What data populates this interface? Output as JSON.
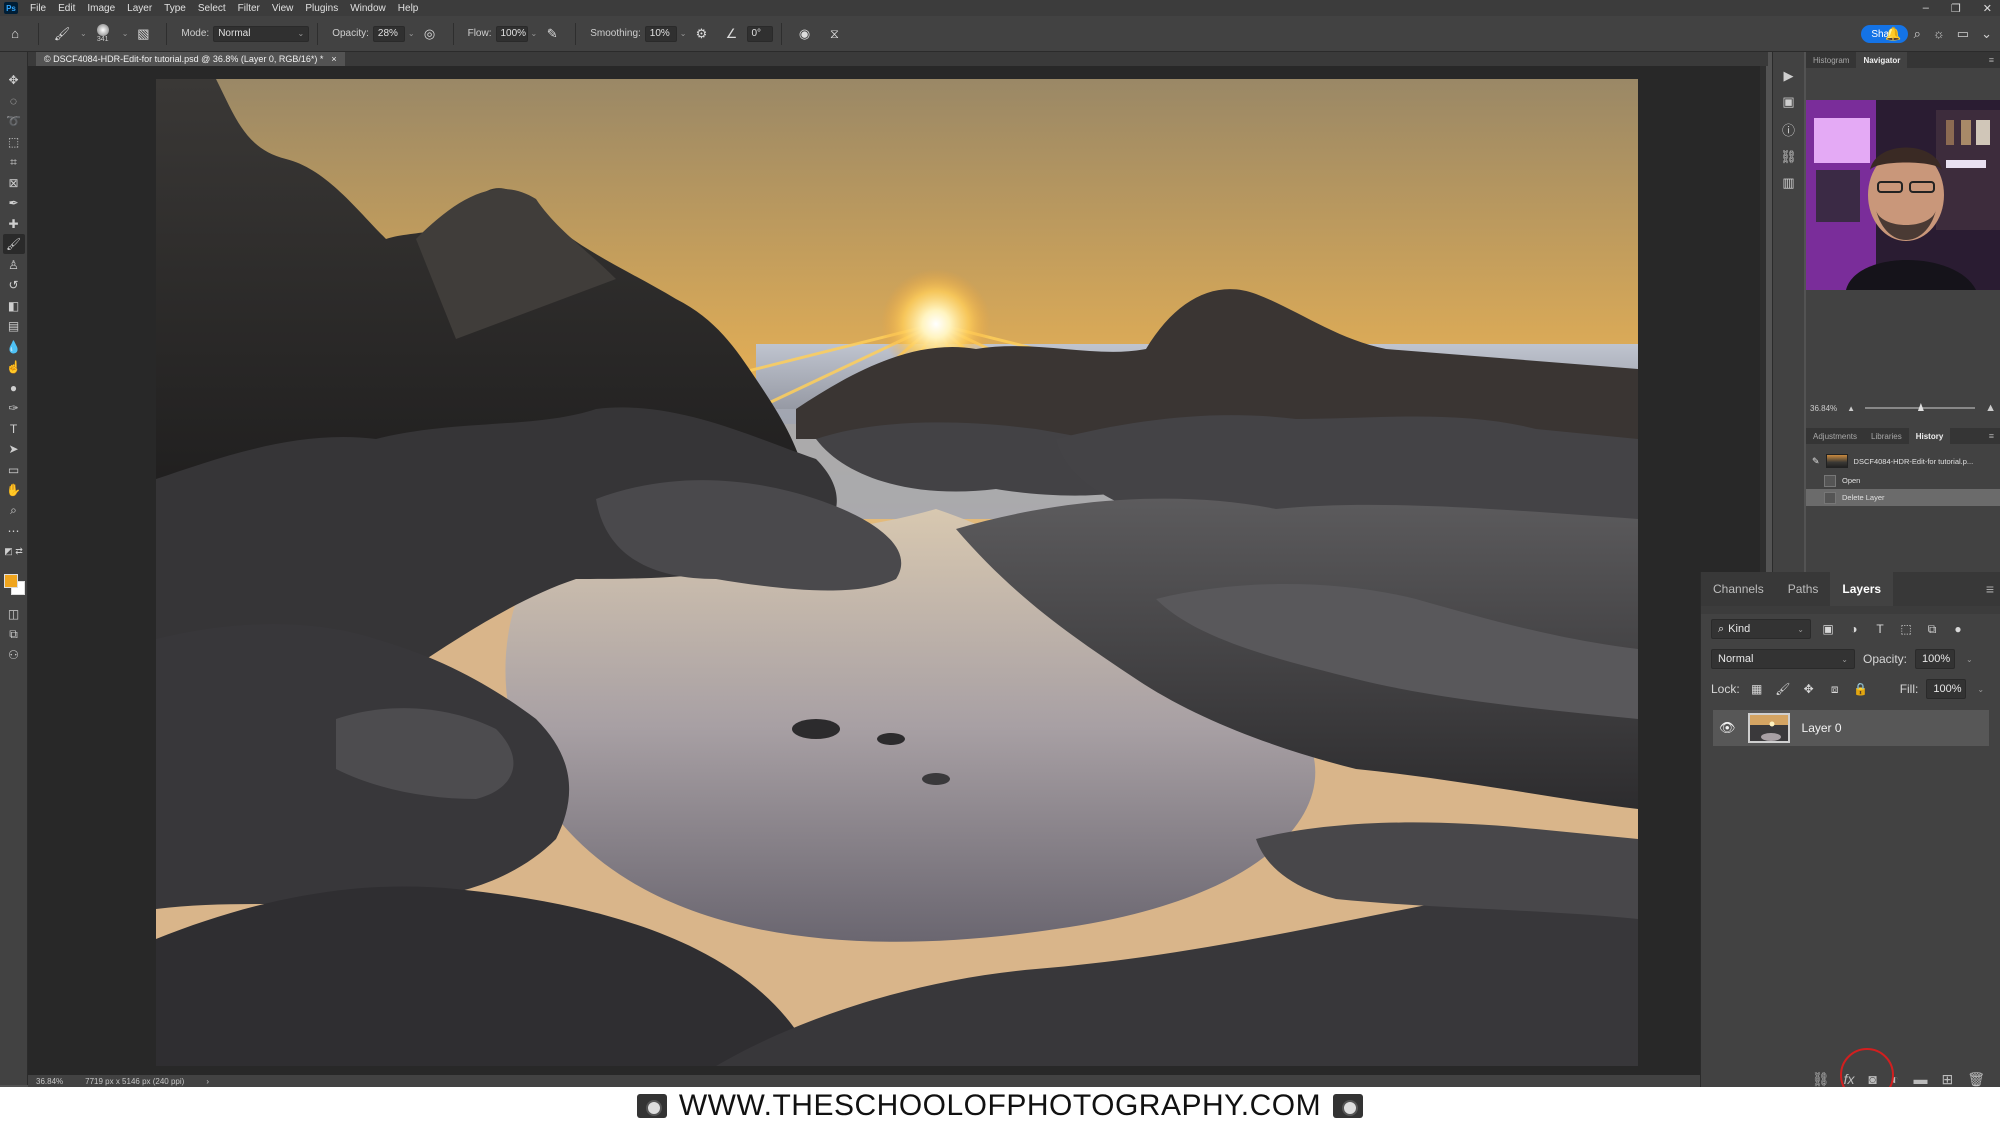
{
  "app": {
    "logo": "Ps"
  },
  "menu": [
    "File",
    "Edit",
    "Image",
    "Layer",
    "Type",
    "Select",
    "Filter",
    "View",
    "Plugins",
    "Window",
    "Help"
  ],
  "window_controls": [
    "–",
    "❐",
    "✕"
  ],
  "options": {
    "brush_size": "341",
    "mode_label": "Mode:",
    "mode_value": "Normal",
    "opacity_label": "Opacity:",
    "opacity_value": "28%",
    "flow_label": "Flow:",
    "flow_value": "100%",
    "smoothing_label": "Smoothing:",
    "smoothing_value": "10%",
    "angle_value": "0°",
    "share_label": "Share"
  },
  "document": {
    "tab_title": "© DSCF4084-HDR-Edit-for tutorial.psd @ 36.8% (Layer 0, RGB/16*) *",
    "tab_close": "×"
  },
  "status": {
    "zoom": "36.84%",
    "dimensions": "7719 px x 5146 px (240 ppi)"
  },
  "navigator_panel": {
    "tabs": [
      "Histogram",
      "Navigator"
    ],
    "active_tab": "Navigator",
    "zoom": "36.84%"
  },
  "history_panel": {
    "tabs": [
      "Adjustments",
      "Libraries",
      "History"
    ],
    "active_tab": "History",
    "snapshot": "DSCF4084-HDR-Edit-for tutorial.p...",
    "steps": [
      "Open",
      "Delete Layer"
    ],
    "selected_step": "Delete Layer"
  },
  "layers_panel": {
    "tabs": [
      "Channels",
      "Paths",
      "Layers"
    ],
    "active_tab": "Layers",
    "filter_kind": "Kind",
    "blend_mode": "Normal",
    "opacity_label": "Opacity:",
    "opacity_value": "100%",
    "lock_label": "Lock:",
    "fill_label": "Fill:",
    "fill_value": "100%",
    "layers": [
      {
        "name": "Layer 0",
        "visible": true
      }
    ]
  },
  "watermark": {
    "text": "WWW.THESCHOOLOFPHOTOGRAPHY.COM"
  },
  "colors": {
    "foreground": "#f0a51e",
    "background": "#ffffff",
    "accent": "#1473e6",
    "highlight_circle": "#d21f1f"
  }
}
